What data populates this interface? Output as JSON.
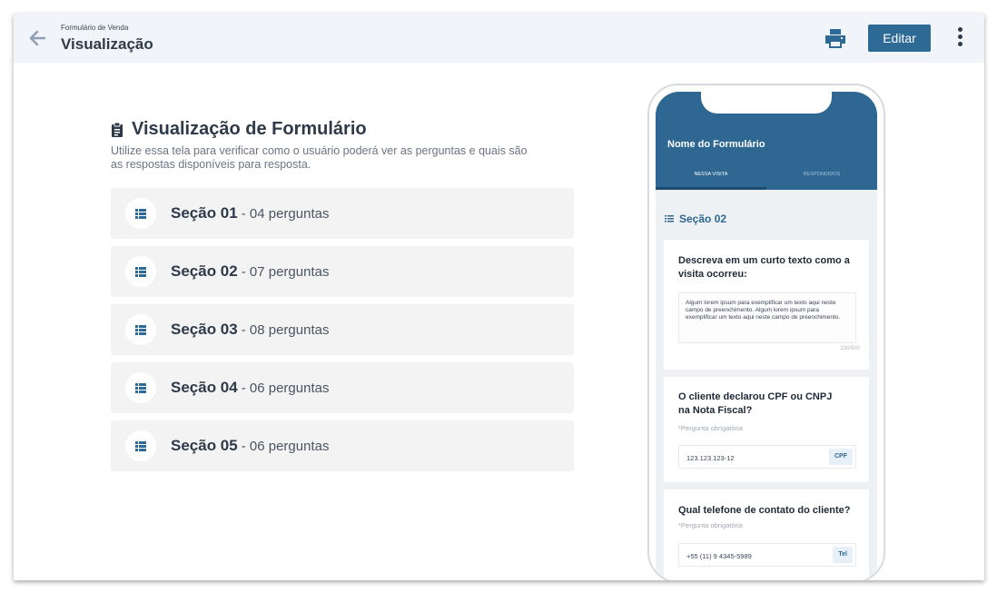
{
  "header": {
    "breadcrumb": "Formulário de Venda",
    "title": "Visualização",
    "edit_label": "Editar"
  },
  "intro": {
    "heading": "Visualização de Formulário",
    "description": "Utilize essa tela para verificar como o usuário poderá ver as perguntas e quais são as respostas disponíveis para resposta."
  },
  "sections": [
    {
      "name": "Seção 01",
      "count": "- 04 perguntas"
    },
    {
      "name": "Seção 02",
      "count": "- 07 perguntas"
    },
    {
      "name": "Seção 03",
      "count": "- 08 perguntas"
    },
    {
      "name": "Seção 04",
      "count": "- 06 perguntas"
    },
    {
      "name": "Seção 05",
      "count": "- 06 perguntas"
    }
  ],
  "preview": {
    "form_name": "Nome do Formulário",
    "tabs": [
      "NESSA VISITA",
      "RESPONDIDOS"
    ],
    "section_title": "Seção 02",
    "questions": [
      {
        "label": "Descreva em um curto texto como a visita ocorreu:",
        "answer": "Algum lorem ipsum para exemplificar um texto aqui neste campo de preenchimento. Algum lorem ipsum para exemplificar um texto aqui neste campo de preenchimento.",
        "char_count": "230/500"
      },
      {
        "label": "O cliente declarou CPF ou CNPJ na Nota Fiscal?",
        "required": "*Pergunta obrigatória",
        "value": "123.123.123-12",
        "tag": "CPF"
      },
      {
        "label": "Qual telefone de contato do cliente?",
        "required": "*Pergunta obrigatória",
        "value": "+55 (11) 9 4345-5989",
        "tag": "Tel"
      }
    ]
  },
  "colors": {
    "primary": "#2e6a96",
    "header_bg": "#f1f4f8",
    "section_bg": "#f3f3f3",
    "phone_header": "#2d6792"
  },
  "icons": {
    "back": "arrow-left-icon",
    "print": "printer-icon",
    "more": "vertical-dots-icon",
    "clipboard": "clipboard-icon",
    "section": "list-icon"
  }
}
